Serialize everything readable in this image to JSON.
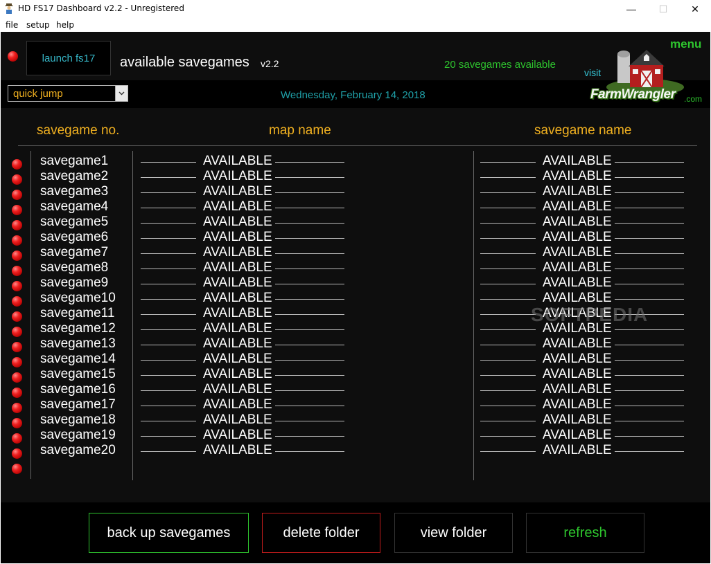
{
  "window": {
    "title": "HD FS17 Dashboard v2.2 - Unregistered",
    "icon": "farmer-icon",
    "controls": {
      "minimize": "—",
      "maximize": "☐",
      "close": "✕"
    }
  },
  "menubar": {
    "items": [
      "file",
      "setup",
      "help"
    ]
  },
  "header": {
    "launch_label": "launch fs17",
    "heading": "available savegames",
    "version": "v2.2",
    "count_text": "20 savegames available",
    "menu_label": "menu",
    "visit_label": "visit",
    "brand": "FarmWrangler",
    "brand_domain": ".com",
    "status_led": "red"
  },
  "toolbar": {
    "quick_jump_value": "quick jump",
    "date": "Wednesday, February 14, 2018"
  },
  "columns": {
    "no": "savegame no.",
    "map": "map name",
    "save": "savegame name"
  },
  "rows": [
    {
      "label": "savegame1",
      "map": "AVAILABLE",
      "name": "AVAILABLE"
    },
    {
      "label": "savegame2",
      "map": "AVAILABLE",
      "name": "AVAILABLE"
    },
    {
      "label": "savegame3",
      "map": "AVAILABLE",
      "name": "AVAILABLE"
    },
    {
      "label": "savegame4",
      "map": "AVAILABLE",
      "name": "AVAILABLE"
    },
    {
      "label": "savegame5",
      "map": "AVAILABLE",
      "name": "AVAILABLE"
    },
    {
      "label": "savegame6",
      "map": "AVAILABLE",
      "name": "AVAILABLE"
    },
    {
      "label": "savegame7",
      "map": "AVAILABLE",
      "name": "AVAILABLE"
    },
    {
      "label": "savegame8",
      "map": "AVAILABLE",
      "name": "AVAILABLE"
    },
    {
      "label": "savegame9",
      "map": "AVAILABLE",
      "name": "AVAILABLE"
    },
    {
      "label": "savegame10",
      "map": "AVAILABLE",
      "name": "AVAILABLE"
    },
    {
      "label": "savegame11",
      "map": "AVAILABLE",
      "name": "AVAILABLE"
    },
    {
      "label": "savegame12",
      "map": "AVAILABLE",
      "name": "AVAILABLE"
    },
    {
      "label": "savegame13",
      "map": "AVAILABLE",
      "name": "AVAILABLE"
    },
    {
      "label": "savegame14",
      "map": "AVAILABLE",
      "name": "AVAILABLE"
    },
    {
      "label": "savegame15",
      "map": "AVAILABLE",
      "name": "AVAILABLE"
    },
    {
      "label": "savegame16",
      "map": "AVAILABLE",
      "name": "AVAILABLE"
    },
    {
      "label": "savegame17",
      "map": "AVAILABLE",
      "name": "AVAILABLE"
    },
    {
      "label": "savegame18",
      "map": "AVAILABLE",
      "name": "AVAILABLE"
    },
    {
      "label": "savegame19",
      "map": "AVAILABLE",
      "name": "AVAILABLE"
    },
    {
      "label": "savegame20",
      "map": "AVAILABLE",
      "name": "AVAILABLE"
    }
  ],
  "footer": {
    "backup": "back up savegames",
    "delete": "delete folder",
    "view": "view folder",
    "refresh": "refresh"
  },
  "watermark": "SOFTPEDIA",
  "colors": {
    "accent_green": "#2ec52e",
    "accent_cyan": "#36b7c8",
    "gold": "#f0b020",
    "led_red": "#e01010",
    "delete_border": "#c41c1c",
    "backup_border": "#2ec52e"
  }
}
